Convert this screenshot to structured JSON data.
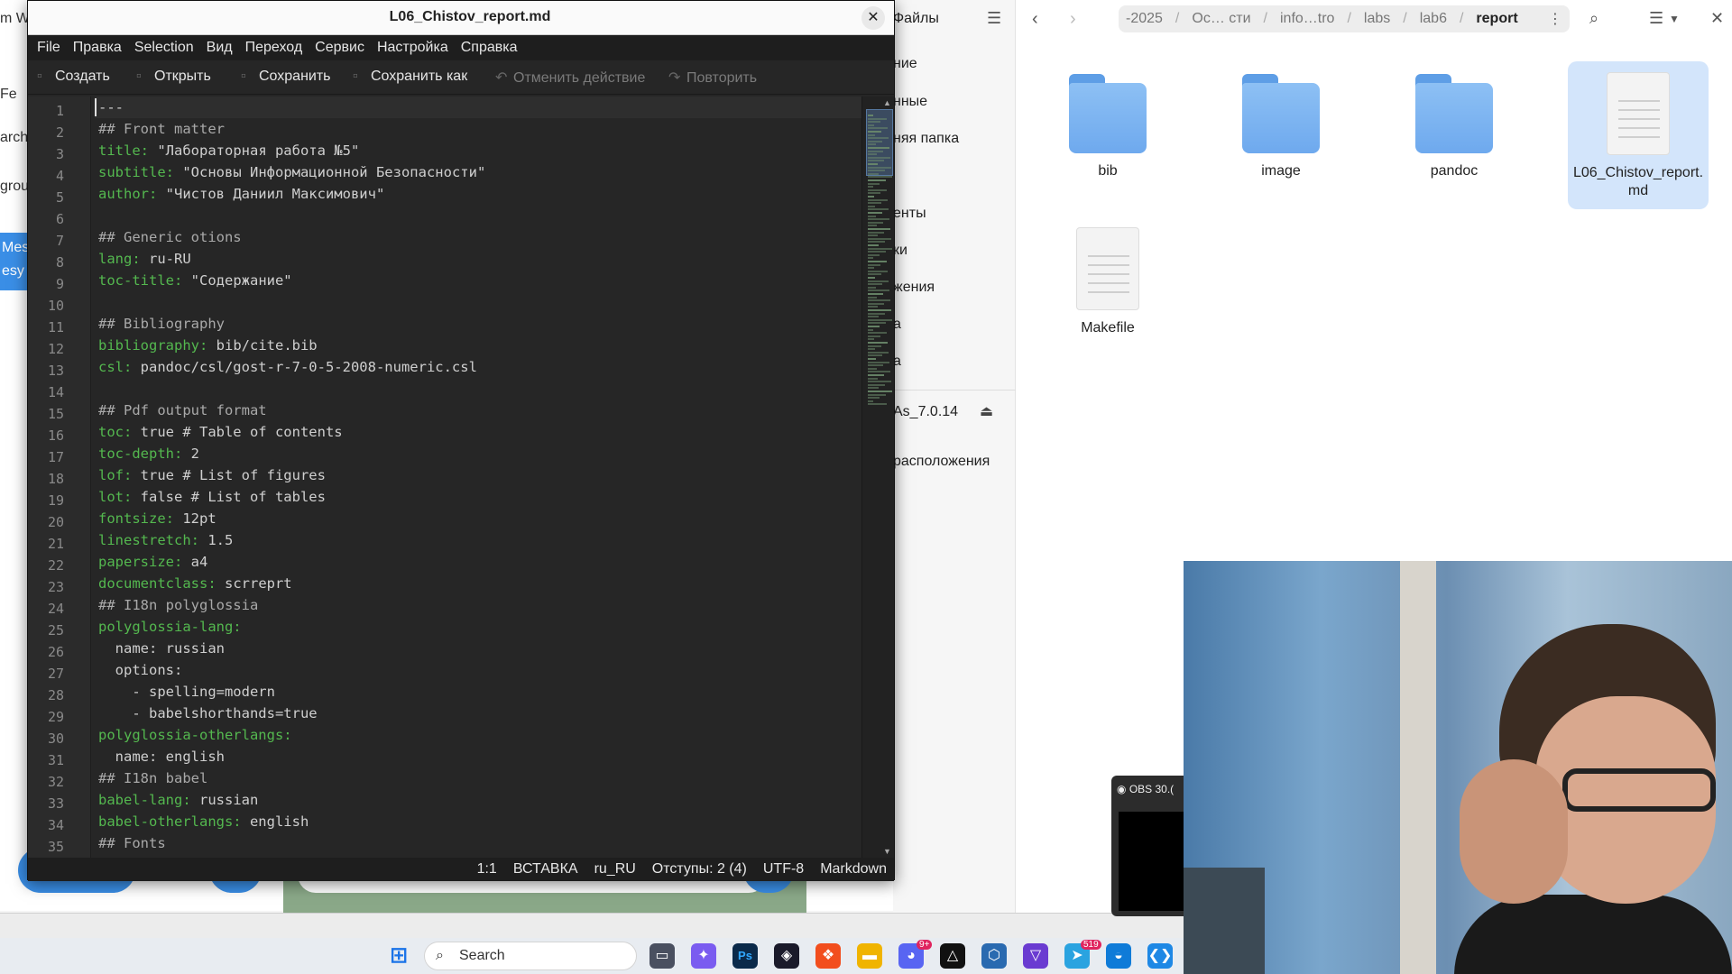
{
  "background_browser": {
    "fragments": [
      "m W",
      "Fe",
      "arch",
      "grou"
    ],
    "blue_labels": [
      "Mes",
      "esy"
    ]
  },
  "file_manager": {
    "sidebar_title": "Файлы",
    "sidebar_items": [
      "ние",
      "нные",
      "няя папка",
      "енты",
      "ки",
      "жения",
      "а",
      "а",
      "As_7.0.14",
      "расположения"
    ],
    "breadcrumbs": [
      "-2025",
      "Ос… сти",
      "info…tro",
      "labs",
      "lab6",
      "report"
    ],
    "files": [
      {
        "name": "bib",
        "type": "folder",
        "selected": false
      },
      {
        "name": "image",
        "type": "folder",
        "selected": false
      },
      {
        "name": "pandoc",
        "type": "folder",
        "selected": false
      },
      {
        "name": "L06_Chistov_report.md",
        "type": "document",
        "selected": true
      },
      {
        "name": "Makefile",
        "type": "document",
        "selected": false
      }
    ]
  },
  "editor": {
    "title": "L06_Chistov_report.md",
    "close_glyph": "✕",
    "menu": [
      "File",
      "Правка",
      "Selection",
      "Вид",
      "Переход",
      "Сервис",
      "Настройка",
      "Справка"
    ],
    "toolbar": {
      "new": "Создать",
      "open": "Открыть",
      "save": "Сохранить",
      "save_as": "Сохранить как",
      "undo": "Отменить действие",
      "redo": "Повторить"
    },
    "lines": [
      [
        [
          "v",
          "---"
        ]
      ],
      [
        [
          "c",
          "## Front matter"
        ]
      ],
      [
        [
          "k",
          "title:"
        ],
        [
          "v",
          " \"Лабораторная работа №5\""
        ]
      ],
      [
        [
          "k",
          "subtitle:"
        ],
        [
          "v",
          " \"Основы Информационной Безопасности\""
        ]
      ],
      [
        [
          "k",
          "author:"
        ],
        [
          "v",
          " \"Чистов Даниил Максимович\""
        ]
      ],
      [],
      [
        [
          "c",
          "## Generic otions"
        ]
      ],
      [
        [
          "k",
          "lang:"
        ],
        [
          "v",
          " ru-RU"
        ]
      ],
      [
        [
          "k",
          "toc-title:"
        ],
        [
          "v",
          " \"Содержание\""
        ]
      ],
      [],
      [
        [
          "c",
          "## Bibliography"
        ]
      ],
      [
        [
          "k",
          "bibliography:"
        ],
        [
          "v",
          " bib/cite.bib"
        ]
      ],
      [
        [
          "k",
          "csl:"
        ],
        [
          "v",
          " pandoc/csl/gost-r-7-0-5-2008-numeric.csl"
        ]
      ],
      [],
      [
        [
          "c",
          "## Pdf output format"
        ]
      ],
      [
        [
          "k",
          "toc:"
        ],
        [
          "v",
          " true # Table of contents"
        ]
      ],
      [
        [
          "k",
          "toc-depth:"
        ],
        [
          "v",
          " 2"
        ]
      ],
      [
        [
          "k",
          "lof:"
        ],
        [
          "v",
          " true # List of figures"
        ]
      ],
      [
        [
          "k",
          "lot:"
        ],
        [
          "v",
          " false # List of tables"
        ]
      ],
      [
        [
          "k",
          "fontsize:"
        ],
        [
          "v",
          " 12pt"
        ]
      ],
      [
        [
          "k",
          "linestretch:"
        ],
        [
          "v",
          " 1.5"
        ]
      ],
      [
        [
          "k",
          "papersize:"
        ],
        [
          "v",
          " a4"
        ]
      ],
      [
        [
          "k",
          "documentclass:"
        ],
        [
          "v",
          " scrreprt"
        ]
      ],
      [
        [
          "c",
          "## I18n polyglossia"
        ]
      ],
      [
        [
          "k",
          "polyglossia-lang:"
        ]
      ],
      [
        [
          "v",
          "  name: russian"
        ]
      ],
      [
        [
          "v",
          "  options:"
        ]
      ],
      [
        [
          "v",
          "    - spelling=modern"
        ]
      ],
      [
        [
          "v",
          "    - babelshorthands=true"
        ]
      ],
      [
        [
          "k",
          "polyglossia-otherlangs:"
        ]
      ],
      [
        [
          "v",
          "  name: english"
        ]
      ],
      [
        [
          "c",
          "## I18n babel"
        ]
      ],
      [
        [
          "k",
          "babel-lang:"
        ],
        [
          "v",
          " russian"
        ]
      ],
      [
        [
          "k",
          "babel-otherlangs:"
        ],
        [
          "v",
          " english"
        ]
      ],
      [
        [
          "c",
          "## Fonts"
        ]
      ]
    ],
    "status": {
      "position": "1:1",
      "mode": "ВСТАВКА",
      "lang": "ru_RU",
      "indent": "Отступы: 2 (4)",
      "encoding": "UTF-8",
      "syntax": "Markdown"
    }
  },
  "obs": {
    "title": "OBS 30.("
  },
  "taskbar": {
    "search_label": "Search",
    "apps": [
      "windows-start",
      "task-view",
      "copilot",
      "photoshop",
      "davinci",
      "figma",
      "file-explorer",
      "discord",
      "app-drive",
      "virtualbox",
      "vpn",
      "telegram",
      "edge",
      "vscode"
    ],
    "discord_badge": "9+",
    "telegram_badge": "519"
  }
}
